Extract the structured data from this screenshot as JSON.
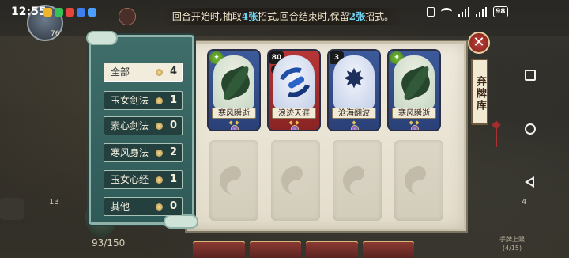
{
  "status_bar": {
    "time": "12:55",
    "battery": "98"
  },
  "hint": {
    "part1": "回合开始时,抽取",
    "draw_count": "4张",
    "part2": "招式,回合结束时,保留",
    "keep_count": "2张",
    "part3": "招式。"
  },
  "filters": [
    {
      "label": "全部",
      "count": "4",
      "active": true
    },
    {
      "label": "玉女剑法",
      "count": "1",
      "active": false
    },
    {
      "label": "素心剑法",
      "count": "0",
      "active": false
    },
    {
      "label": "寒风身法",
      "count": "2",
      "active": false
    },
    {
      "label": "玉女心经",
      "count": "1",
      "active": false
    },
    {
      "label": "其他",
      "count": "0",
      "active": false
    }
  ],
  "cards": [
    {
      "name": "寒风瞬逝",
      "cost": "",
      "color": "blue",
      "art": "jade"
    },
    {
      "name": "浪迹天涯",
      "cost": "80",
      "color": "red",
      "art": "sky",
      "tag": "1"
    },
    {
      "name": "沧海翻波",
      "cost": "3",
      "color": "blue",
      "art": "sky"
    },
    {
      "name": "寒风瞬逝",
      "cost": "",
      "color": "blue",
      "art": "jade"
    }
  ],
  "discard_label": "弃牌库",
  "close_icon": "close-icon",
  "hud": {
    "avatar_level": "76",
    "hp": "93/150",
    "left_count": "13",
    "right_count": "4",
    "hand_limit": "手牌上限",
    "hand_limit_value": "(4/15)"
  },
  "colors": {
    "panel": "#efeadd",
    "sidebar": "#3f6e6a",
    "highlight": "#6fd3f0",
    "card_blue": "#3c5a9b",
    "card_red": "#b73636"
  }
}
